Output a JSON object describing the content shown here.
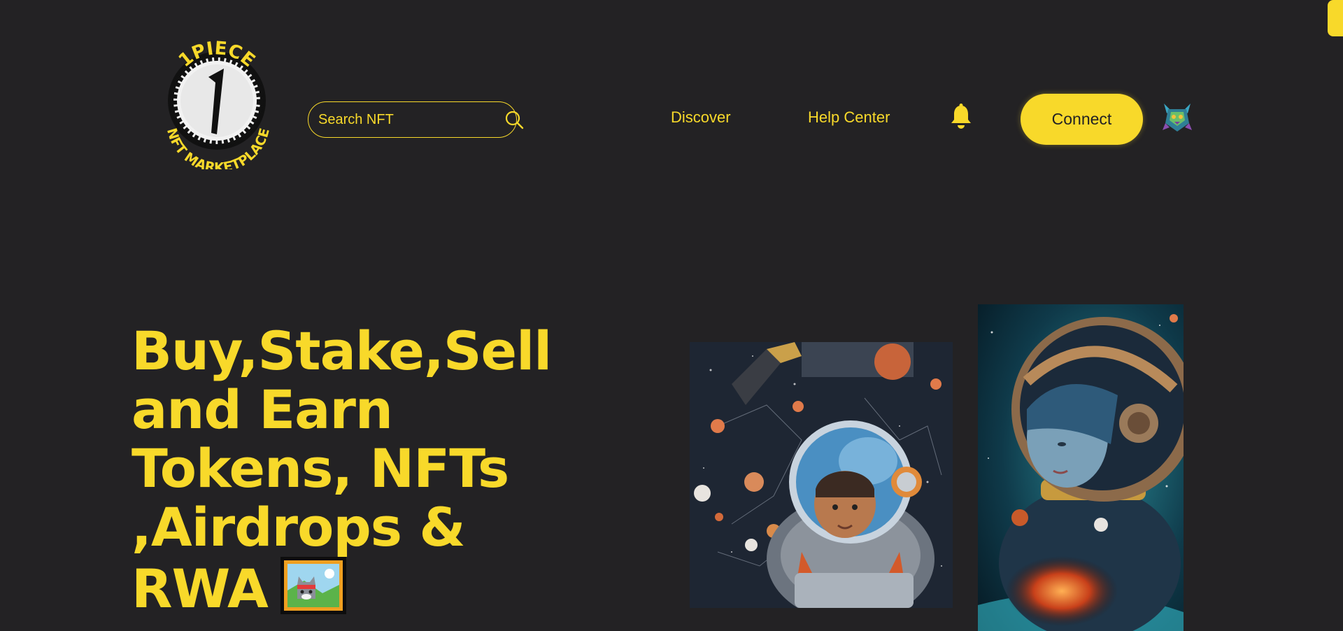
{
  "header": {
    "logo": {
      "top_text": "1PIECE",
      "bottom_text": "NFT MARKETPLACE",
      "glyph": "1"
    },
    "search": {
      "placeholder": "Search NFT",
      "value": "",
      "icon": "search-icon"
    },
    "nav": [
      {
        "label": "Discover"
      },
      {
        "label": "Help Center"
      }
    ],
    "notifications_icon": "bell-icon",
    "connect_label": "Connect",
    "avatar_icon": "robot-avatar"
  },
  "hero": {
    "headline_lines": [
      "Buy,Stake,Sell",
      "and Earn",
      "Tokens, NFTs",
      ",Airdrops &",
      "RWA"
    ],
    "inline_icon": "picture-frame-icon",
    "artworks": [
      {
        "name": "astronaut-boy-artwork"
      },
      {
        "name": "astronaut-woman-artwork"
      }
    ]
  },
  "theme": {
    "accent": "#f8d92a",
    "background": "#232224"
  }
}
